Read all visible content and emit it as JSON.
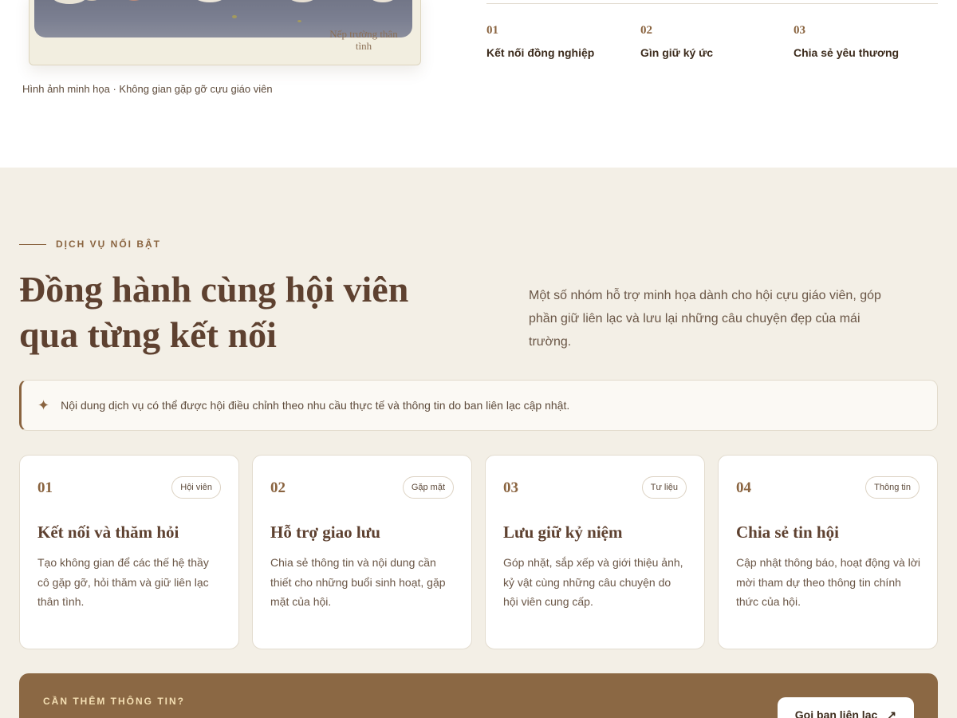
{
  "top": {
    "photo_stamp": "Nếp trường thân tình",
    "photo_caption": "Hình ảnh minh họa · Không gian gặp gỡ cựu giáo viên",
    "features": [
      {
        "num": "01",
        "label": "Kết nối đồng nghiệp"
      },
      {
        "num": "02",
        "label": "Gìn giữ ký ức"
      },
      {
        "num": "03",
        "label": "Chia sẻ yêu thương"
      }
    ]
  },
  "services": {
    "eyebrow": "DỊCH VỤ NỔI BẬT",
    "headline_line1": "Đồng hành cùng hội viên",
    "headline_line2": "qua từng kết nối",
    "intro": "Một số nhóm hỗ trợ minh họa dành cho hội cựu giáo viên, góp phần giữ liên lạc và lưu lại những câu chuyện đẹp của mái trường.",
    "notice_icon": "sparkle-icon",
    "notice": "Nội dung dịch vụ có thể được hội điều chỉnh theo nhu cầu thực tế và thông tin do ban liên lạc cập nhật.",
    "cards": [
      {
        "num": "01",
        "tag": "Hội viên",
        "title": "Kết nối và thăm hỏi",
        "desc": "Tạo không gian để các thế hệ thầy cô gặp gỡ, hỏi thăm và giữ liên lạc thân tình."
      },
      {
        "num": "02",
        "tag": "Gặp mặt",
        "title": "Hỗ trợ giao lưu",
        "desc": "Chia sẻ thông tin và nội dung cần thiết cho những buổi sinh hoạt, gặp mặt của hội."
      },
      {
        "num": "03",
        "tag": "Tư liệu",
        "title": "Lưu giữ kỷ niệm",
        "desc": "Góp nhặt, sắp xếp và giới thiệu ảnh, kỷ vật cùng những câu chuyện do hội viên cung cấp."
      },
      {
        "num": "04",
        "tag": "Thông tin",
        "title": "Chia sẻ tin hội",
        "desc": "Cập nhật thông báo, hoạt động và lời mời tham dự theo thông tin chính thức của hội."
      }
    ]
  },
  "cta": {
    "eyebrow": "CẦN THÊM THÔNG TIN?",
    "button_label": "Gọi ban liên lạc",
    "button_icon": "arrow-up-right-icon"
  },
  "colors": {
    "accent": "#8a6440",
    "heading": "#5e4130",
    "section_bg": "#f3efe6",
    "cta_bg": "#8b6844"
  }
}
